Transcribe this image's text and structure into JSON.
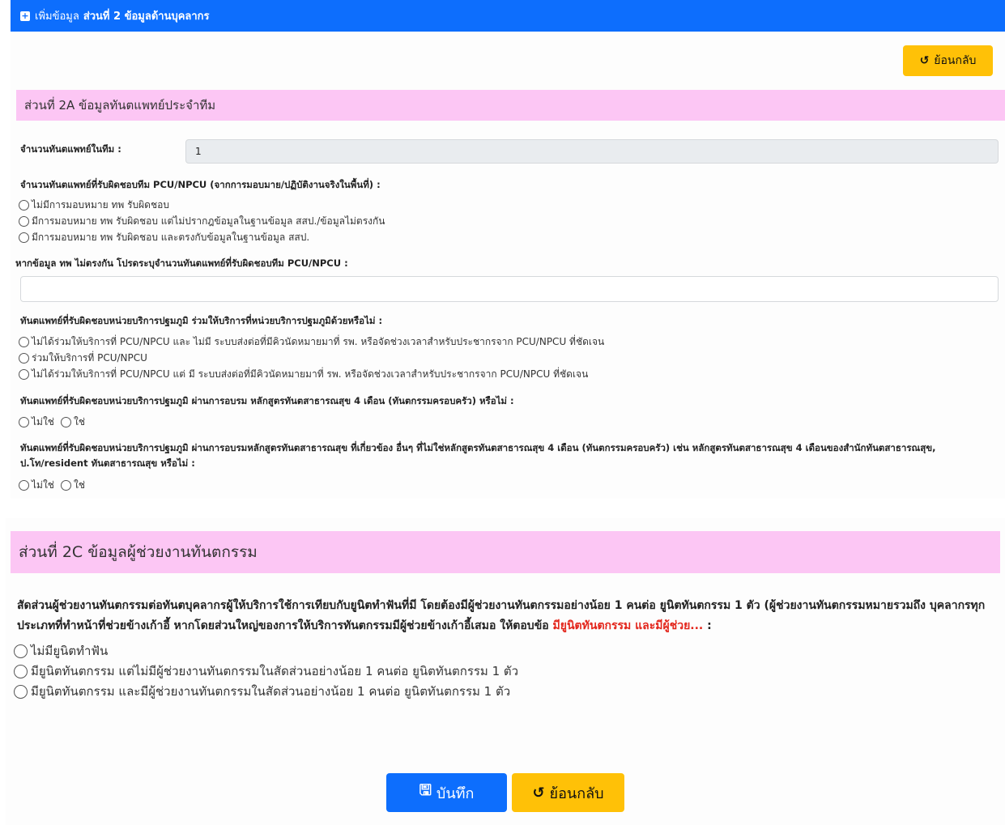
{
  "header": {
    "lead": "เพิ่มข้อมูล",
    "title": "ส่วนที่ 2 ข้อมูลด้านบุคลากร"
  },
  "section_a": {
    "back_label": "ย้อนกลับ",
    "title": "ส่วนที่ 2A ข้อมูลทันตแพทย์ประจำทีม",
    "dentist_count_label": "จำนวนทันตแพทย์ในทีม :",
    "dentist_count_value": "1",
    "q1": {
      "label": "จำนวนทันตแพทย์ที่รับผิดชอบทีม PCU/NPCU (จากการมอบมาย/ปฏิบัติงานจริงในพื้นที่) :",
      "options": [
        "ไม่มีการมอบหมาย ทพ รับผิดชอบ",
        "มีการมอบหมาย ทพ รับผิดชอบ แต่ไม่ปรากฎข้อมูลในฐานข้อมูล สสป./ข้อมูลไม่ตรงกัน",
        "มีการมอบหมาย ทพ รับผิดชอบ และตรงกับข้อมูลในฐานข้อมูล สสป."
      ]
    },
    "q2": {
      "label": "หากข้อมูล ทพ ไม่ตรงกัน โปรดระบุจำนวนทันตแพทย์ที่รับผิดชอบทีม PCU/NPCU :",
      "value": ""
    },
    "q3": {
      "label": "ทันตแพทย์ที่รับผิดชอบหน่วยบริการปฐมภูมิ ร่วมให้บริการที่หน่วยบริการปฐมภูมิด้วยหรือไม่ :",
      "options": [
        "ไม่ได้ร่วมให้บริการที่ PCU/NPCU และ ไม่มี ระบบส่งต่อที่มีคิวนัดหมายมาที่ รพ. หรือจัดช่วงเวลาสำหรับประชากรจาก PCU/NPCU ที่ชัดเจน",
        "ร่วมให้บริการที่ PCU/NPCU",
        "ไม่ได้ร่วมให้บริการที่ PCU/NPCU แต่ มี ระบบส่งต่อที่มีคิวนัดหมายมาที่ รพ. หรือจัดช่วงเวลาสำหรับประชากรจาก PCU/NPCU ที่ชัดเจน"
      ]
    },
    "q4": {
      "label": "ทันตแพทย์ที่รับผิดชอบหน่วยบริการปฐมภูมิ ผ่านการอบรม หลักสูตรทันตสาธารณสุข 4 เดือน (ทันตกรรมครอบครัว) หรือไม่ :",
      "options": [
        "ไม่ใช่",
        "ใช่"
      ]
    },
    "q5": {
      "label": "ทันตแพทย์ที่รับผิดชอบหน่วยบริการปฐมภูมิ ผ่านการอบรมหลักสูตรทันตสาธารณสุข ที่เกี่ยวข้อง อื่นๆ ที่ไม่ใช่หลักสูตรทันตสาธารณสุข 4 เดือน (ทันตกรรมครอบครัว) เช่น หลักสูตรทันตสาธารณสุข 4 เดือนของสำนักทันตสาธารณสุข, ป.โท/resident ทันตสาธารณสุข หรือไม่ :",
      "options": [
        "ไม่ใช่",
        "ใช่"
      ]
    }
  },
  "section_c": {
    "title": "ส่วนที่ 2C ข้อมูลผู้ช่วยงานทันตกรรม",
    "question": "สัดส่วนผู้ช่วยงานทันตกรรมต่อทันตบุคลากรผู้ให้บริการใช้การเทียบกับยูนิตทำฟันที่มี โดยต้องมีผู้ช่วยงานทันตกรรมอย่างน้อย 1 คนต่อ ยูนิตทันตกรรม 1 ตัว (ผู้ช่วยงานทันตกรรมหมายรวมถึง บุคลากรทุกประเภทที่ทำหน้าที่ช่วยข้างเก้าอี้ หากโดยส่วนใหญ่ของการให้บริการทันตกรรมมีผู้ช่วยข้างเก้าอี้เสมอ ให้ตอบข้อ",
    "question_highlight": "มียูนิตทันตกรรม และมีผู้ช่วย...",
    "question_suffix": " :",
    "options": [
      "ไม่มียูนิตทำฟัน",
      "มียูนิตทันตกรรม แต่ไม่มีผู้ช่วยงานทันตกรรมในสัดส่วนอย่างน้อย 1 คนต่อ ยูนิตทันตกรรม 1 ตัว",
      "มียูนิตทันตกรรม และมีผู้ช่วยงานทันตกรรมในสัดส่วนอย่างน้อย 1 คนต่อ ยูนิตทันตกรรม 1 ตัว"
    ],
    "save_label": "บันทึก",
    "back_label": "ย้อนกลับ"
  },
  "colors": {
    "primary": "#0d6efd",
    "warning": "#ffc107",
    "section_header": "#fcc6f4",
    "highlight_red": "#e3261c"
  }
}
